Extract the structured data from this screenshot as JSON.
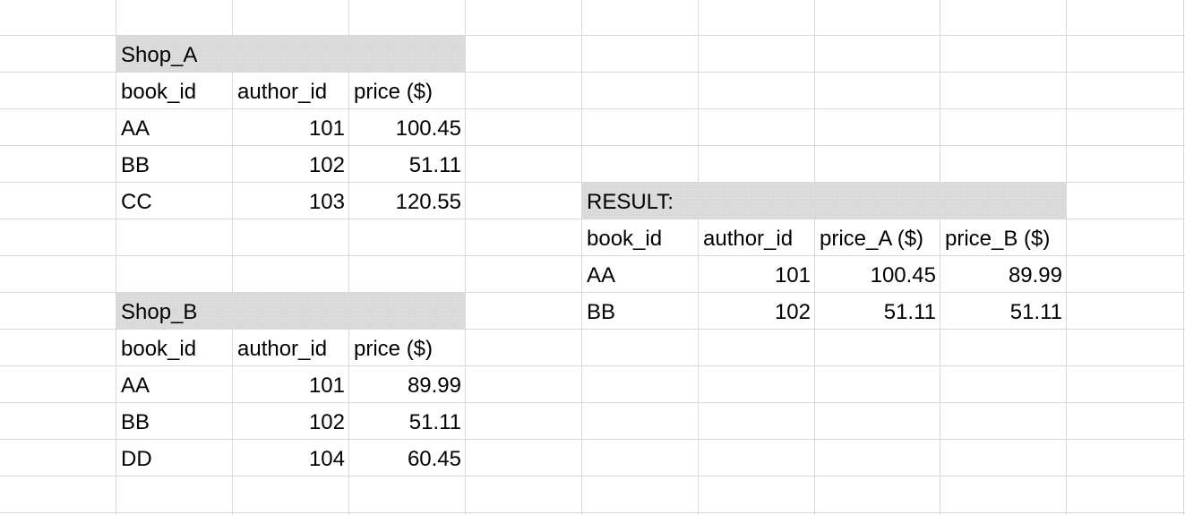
{
  "shop_a": {
    "title": "Shop_A",
    "headers": [
      "book_id",
      "author_id",
      "price ($)"
    ],
    "rows": [
      [
        "AA",
        "101",
        "100.45"
      ],
      [
        "BB",
        "102",
        "51.11"
      ],
      [
        "CC",
        "103",
        "120.55"
      ]
    ]
  },
  "shop_b": {
    "title": "Shop_B",
    "headers": [
      "book_id",
      "author_id",
      "price ($)"
    ],
    "rows": [
      [
        "AA",
        "101",
        "89.99"
      ],
      [
        "BB",
        "102",
        "51.11"
      ],
      [
        "DD",
        "104",
        "60.45"
      ]
    ]
  },
  "result": {
    "title": "RESULT:",
    "headers": [
      "book_id",
      "author_id",
      "price_A ($)",
      "price_B ($)"
    ],
    "rows": [
      [
        "AA",
        "101",
        "100.45",
        "89.99"
      ],
      [
        "BB",
        "102",
        "51.11",
        "51.11"
      ]
    ]
  },
  "colors": {
    "gridline": "#d9d9d9",
    "header_fill": "#d9d9d9",
    "text": "#000000"
  }
}
